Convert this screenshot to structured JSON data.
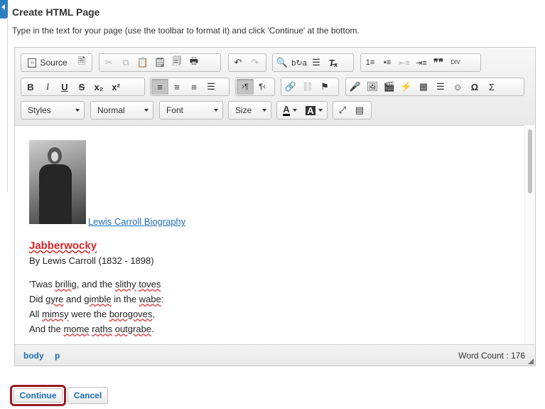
{
  "page": {
    "title": "Create HTML Page",
    "instructions": "Type in the text for your page (use the toolbar to format it) and click 'Continue' at the bottom."
  },
  "toolbar": {
    "source_label": "Source",
    "styles_label": "Styles",
    "format_label": "Normal",
    "font_label": "Font",
    "size_label": "Size"
  },
  "content": {
    "bio_link": "Lewis Carroll Biography",
    "poem_title": "Jabberwocky",
    "byline": "By Lewis Carroll (1832 - 1898)",
    "lines": [
      [
        "'Twas ",
        "brillig",
        ", and the ",
        "slithy",
        " ",
        "toves",
        ""
      ],
      [
        "Did ",
        "gyre",
        " and ",
        "gimble",
        " in the ",
        "wabe",
        ":"
      ],
      [
        "All ",
        "mimsy",
        " were the ",
        "borogoves",
        ",",
        "",
        ""
      ],
      [
        "And the ",
        "mome",
        " ",
        "raths",
        " ",
        "outgrabe",
        "."
      ]
    ]
  },
  "status": {
    "path": [
      "body",
      "p"
    ],
    "word_count": "Word Count : 176"
  },
  "actions": {
    "continue_label": "Continue",
    "cancel_label": "Cancel"
  },
  "colors": {
    "accent": "#1f6fb5",
    "highlight_border": "#9a1b22",
    "title_red": "#d2262a"
  }
}
